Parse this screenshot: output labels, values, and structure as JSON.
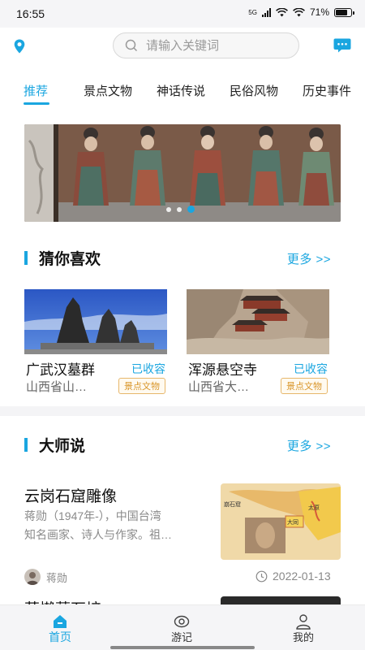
{
  "status_bar": {
    "time": "16:55",
    "network": "5G",
    "battery": "71%"
  },
  "header": {
    "location_icon": "location-pin-icon",
    "search_placeholder": "请输入关键词",
    "message_icon": "message-icon",
    "accent_color": "#1aa6e0"
  },
  "tabs": [
    {
      "label": "推荐",
      "active": true
    },
    {
      "label": "景点文物"
    },
    {
      "label": "神话传说"
    },
    {
      "label": "民俗风物"
    },
    {
      "label": "历史事件"
    }
  ],
  "banner": {
    "slide_count": 3,
    "active_slide": 3
  },
  "guess_section": {
    "title": "猜你喜欢",
    "more": "更多 >>",
    "cards": [
      {
        "title": "广武汉墓群",
        "favorite": "已收容",
        "location": "山西省山…",
        "tag": "景点文物"
      },
      {
        "title": "浑源悬空寺",
        "favorite": "已收容",
        "location": "山西省大…",
        "tag": "景点文物"
      }
    ]
  },
  "master_section": {
    "title": "大师说",
    "more": "更多 >>",
    "articles": [
      {
        "title": "云岗石窟雕像",
        "desc_line1": "蒋勋（1947年-），中国台湾",
        "desc_line2": "知名画家、诗人与作家。祖…",
        "author": "蒋勋",
        "date": "2022-01-13",
        "map_labels": [
          "崩石窟",
          "太原",
          "大同"
        ]
      },
      {
        "title": "茅懒蓐石培"
      }
    ]
  },
  "bottom_nav": [
    {
      "label": "首页",
      "icon": "home-icon",
      "active": true
    },
    {
      "label": "游记",
      "icon": "eye-icon"
    },
    {
      "label": "我的",
      "icon": "user-icon"
    }
  ]
}
